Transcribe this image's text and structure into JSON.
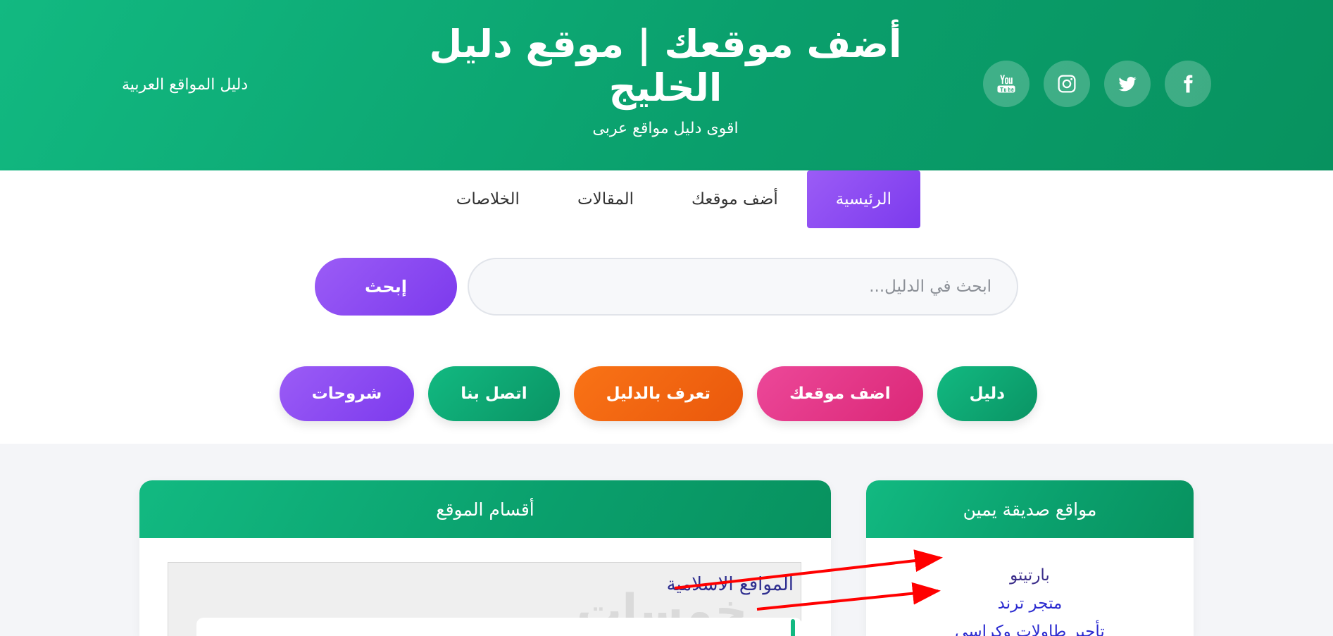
{
  "header": {
    "title": "أضف موقعك | موقع دليل الخليج",
    "tagline": "اقوى دليل مواقع عربى",
    "left_link": "دليل المواقع العربية",
    "social": [
      {
        "name": "facebook-icon"
      },
      {
        "name": "twitter-icon"
      },
      {
        "name": "instagram-icon"
      },
      {
        "name": "youtube-icon"
      }
    ]
  },
  "nav": {
    "items": [
      {
        "label": "الرئيسية",
        "active": true
      },
      {
        "label": "أضف موقعك"
      },
      {
        "label": "المقالات"
      },
      {
        "label": "الخلاصات"
      }
    ]
  },
  "search": {
    "placeholder": "ابحث في الدليل...",
    "button_label": "إبحث"
  },
  "quick_links": [
    {
      "label": "دليل",
      "color": "#10b981"
    },
    {
      "label": "اضف موقعك",
      "color": "#ec4899"
    },
    {
      "label": "تعرف بالدليل",
      "color": "#f97316"
    },
    {
      "label": "اتصل بنا",
      "color": "#10b981"
    },
    {
      "label": "شروحات",
      "color": "#8b5cf6"
    }
  ],
  "friends_panel": {
    "title": "مواقع صديقة يمين",
    "items": [
      "بارتيتو",
      "متجر ترند",
      "تأجير طاولات وكراسي"
    ]
  },
  "sections_panel": {
    "title": "أقسام الموقع",
    "first_section": "المواقع الاسلامية",
    "watermark": "خمسات"
  },
  "colors": {
    "primary_green": "#10b981",
    "accent_purple": "#8b5cf6",
    "annotation_red": "#ff0000"
  }
}
